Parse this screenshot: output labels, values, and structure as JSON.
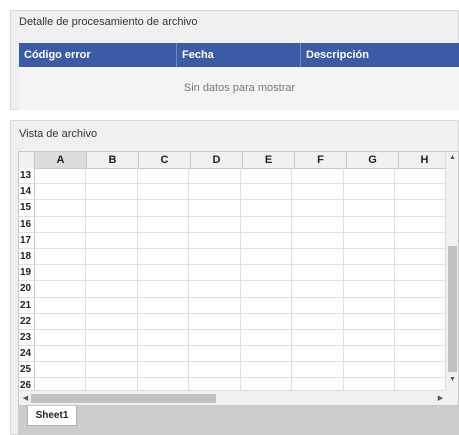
{
  "processing_panel": {
    "title": "Detalle de procesamiento de archivo",
    "columns": [
      "Código error",
      "Fecha",
      "Descripción"
    ],
    "empty_message": "Sin datos para mostrar"
  },
  "file_view_panel": {
    "title": "Vista de archivo",
    "column_headers": [
      "A",
      "B",
      "C",
      "D",
      "E",
      "F",
      "G",
      "H"
    ],
    "selected_column": "A",
    "row_headers": [
      "13",
      "14",
      "15",
      "16",
      "17",
      "18",
      "19",
      "20",
      "21",
      "22",
      "23",
      "24",
      "25",
      "26"
    ],
    "sheet_tabs": [
      "Sheet1"
    ],
    "scroll_up_icon": "triangle-up-icon",
    "scroll_down_icon": "triangle-down-icon",
    "scroll_left_icon": "triangle-left-icon",
    "scroll_right_icon": "triangle-right-icon"
  }
}
